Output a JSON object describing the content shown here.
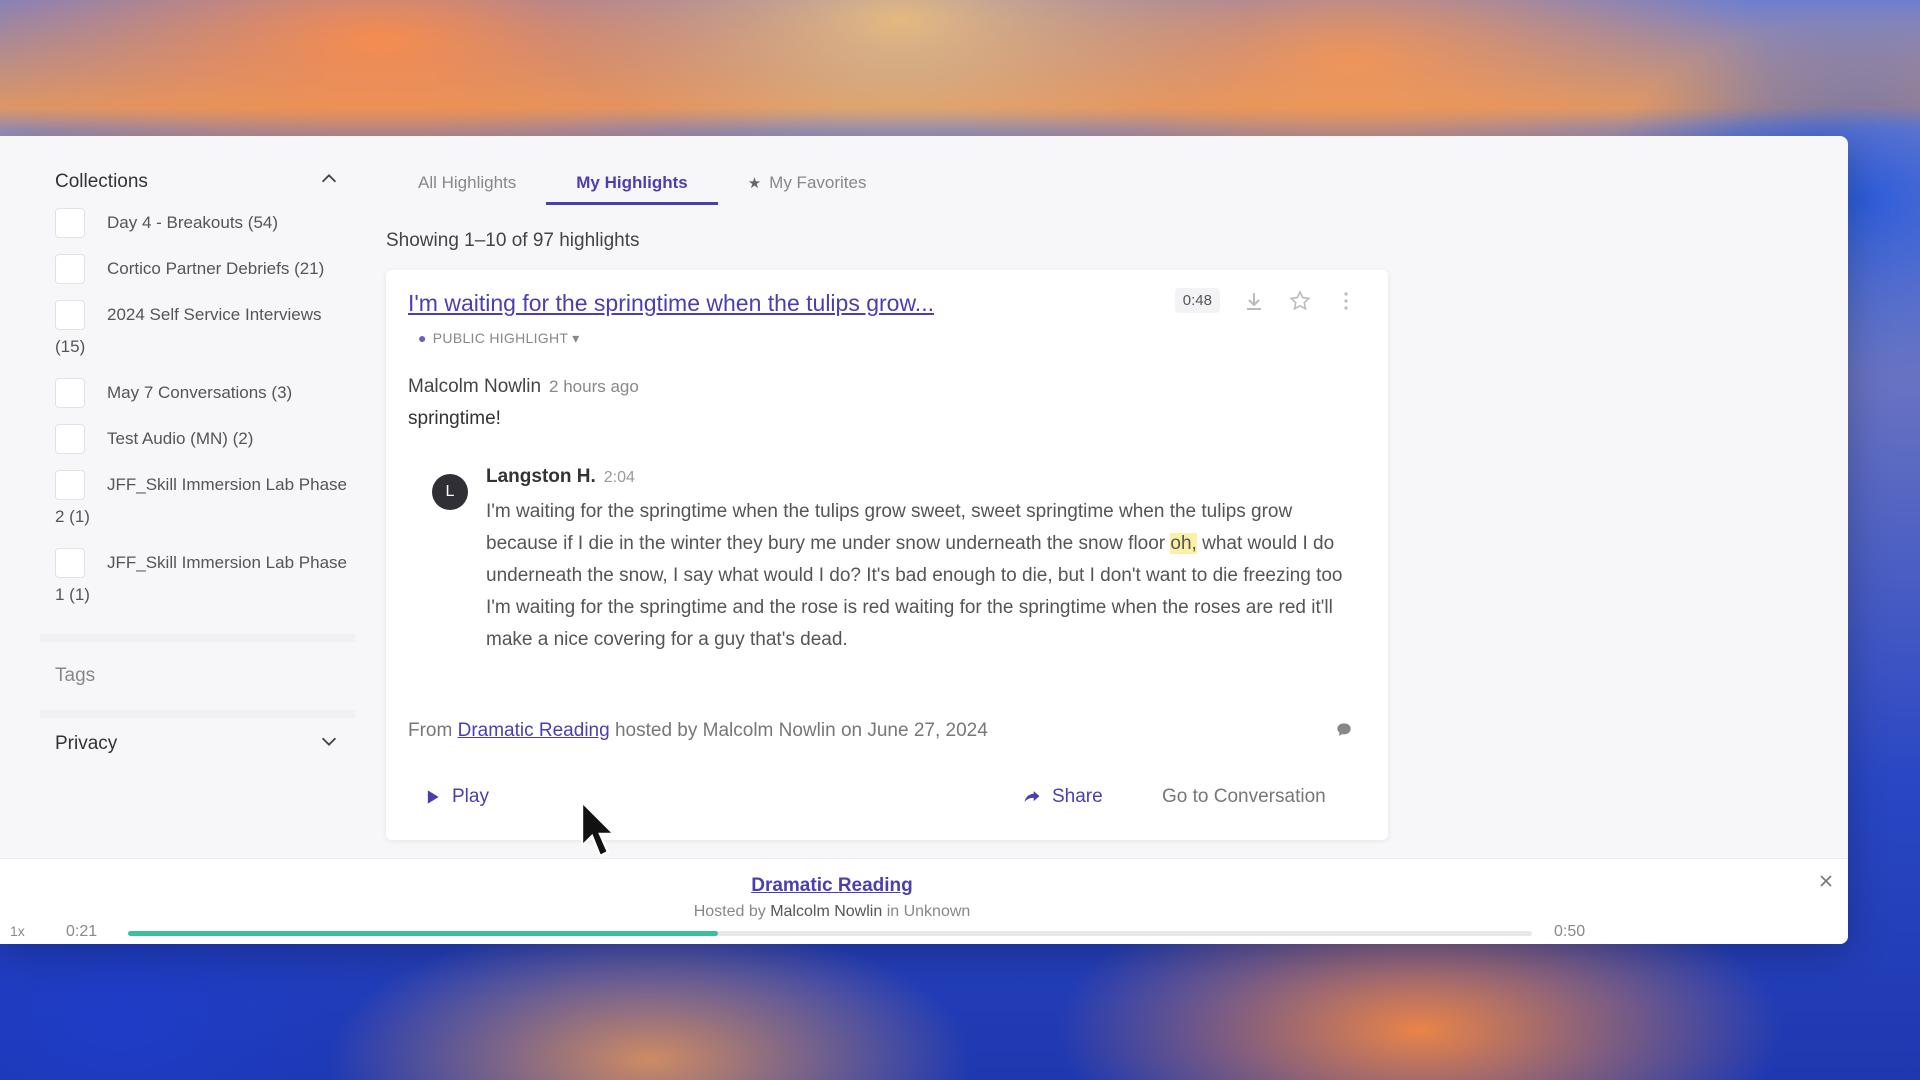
{
  "sidebar": {
    "collections_title": "Collections",
    "collections": [
      {
        "label": "Day 4 - Breakouts (54)"
      },
      {
        "label": "Cortico Partner Debriefs (21)"
      },
      {
        "label": "2024 Self Service Interviews (15)"
      },
      {
        "label": "May 7 Conversations (3)"
      },
      {
        "label": "Test Audio (MN) (2)"
      },
      {
        "label": "JFF_Skill Immersion Lab Phase 2 (1)"
      },
      {
        "label": "JFF_Skill Immersion Lab Phase 1 (1)"
      }
    ],
    "tags_title": "Tags",
    "privacy_title": "Privacy"
  },
  "tabs": [
    {
      "label": "All Highlights",
      "active": false
    },
    {
      "label": "My Highlights",
      "active": true
    },
    {
      "label": "My Favorites",
      "active": false,
      "icon": "star-icon"
    }
  ],
  "showing": "Showing 1–10 of 97 highlights",
  "highlight": {
    "title": "I'm waiting for the springtime when the tulips grow...",
    "duration": "0:48",
    "visibility": "PUBLIC HIGHLIGHT",
    "author": "Malcolm Nowlin",
    "time_ago": "2 hours ago",
    "note": "springtime!",
    "speaker_initial": "L",
    "speaker": "Langston H.",
    "speaker_time": "2:04",
    "transcript_before": "I'm waiting for the springtime when the tulips grow sweet, sweet springtime when the tulips grow because if I die in the winter they bury me under snow underneath the snow floor ",
    "transcript_highlight": "oh,",
    "transcript_after": " what would I do underneath the snow, I say what would I do? It's bad enough to die, but I don't want to die freezing too I'm waiting for the springtime and the rose is red waiting for the springtime when the roses are red it'll make a nice covering for a guy that's dead.",
    "source_from": "From",
    "source_link": "Dramatic Reading",
    "source_rest": "hosted by Malcolm Nowlin on June 27, 2024",
    "play_label": "Play",
    "share_label": "Share",
    "go_label": "Go to Conversation"
  },
  "player": {
    "title": "Dramatic Reading",
    "hosted_by": "Hosted by",
    "host": "Malcolm Nowlin",
    "location": "in Unknown",
    "speed": "1x",
    "current_time": "0:21",
    "total_time": "0:50",
    "progress": 0.42
  },
  "colors": {
    "accent": "#4a3fb0",
    "progress": "#3dbf9e",
    "highlight": "#fbf0a6"
  }
}
